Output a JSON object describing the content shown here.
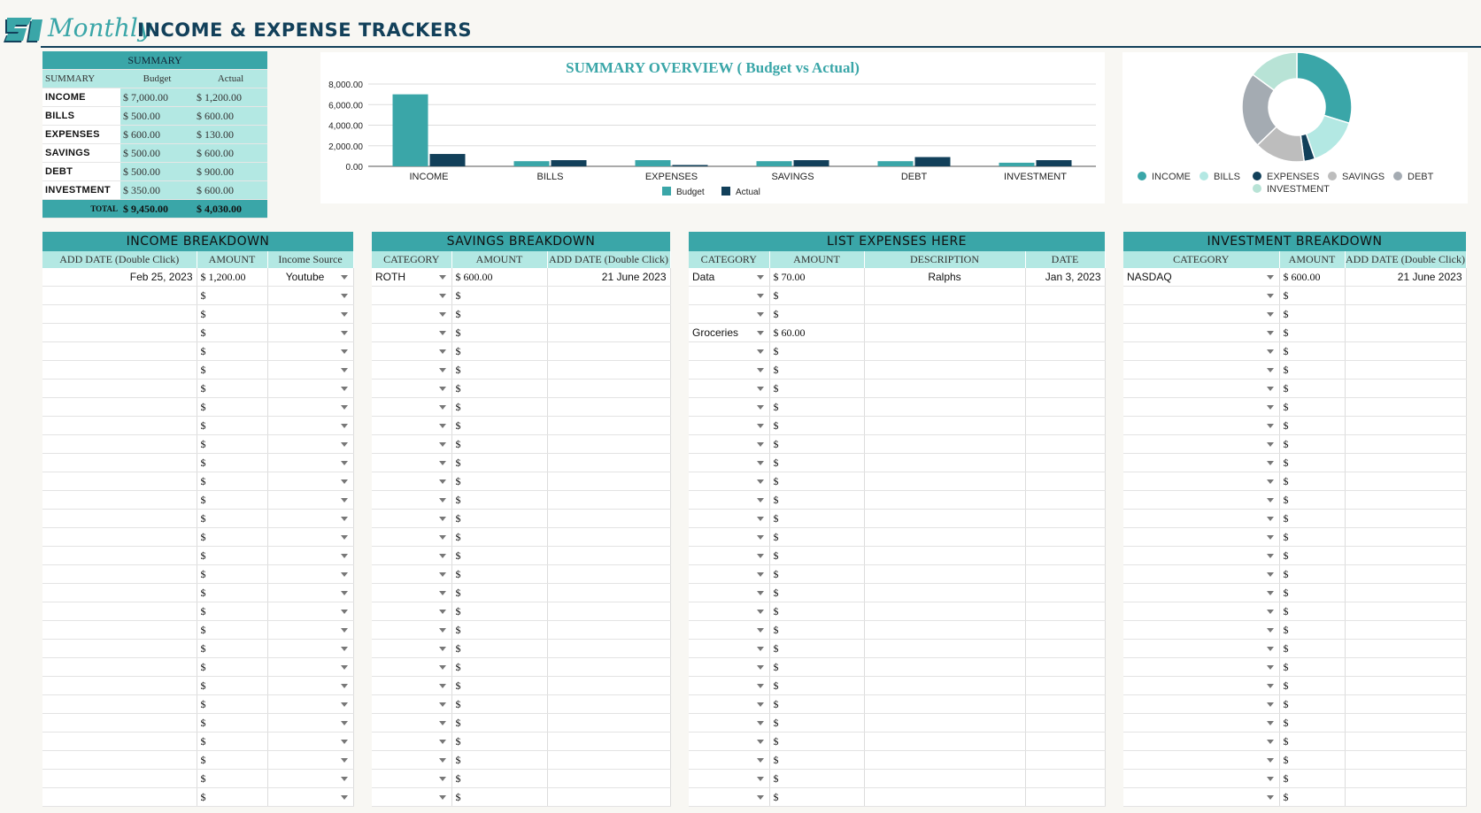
{
  "header": {
    "logo_text": "SI",
    "title_script": "Monthly",
    "title_main": "INCOME & EXPENSE TRACKERS"
  },
  "summary": {
    "title": "SUMMARY",
    "col_label": "SUMMARY",
    "col_budget": "Budget",
    "col_actual": "Actual",
    "rows": [
      {
        "label": "INCOME",
        "budget": "$ 7,000.00",
        "actual": "$ 1,200.00"
      },
      {
        "label": "BILLS",
        "budget": "$ 500.00",
        "actual": "$ 600.00"
      },
      {
        "label": "EXPENSES",
        "budget": "$ 600.00",
        "actual": "$ 130.00"
      },
      {
        "label": "SAVINGS",
        "budget": "$ 500.00",
        "actual": "$ 600.00"
      },
      {
        "label": "DEBT",
        "budget": "$ 500.00",
        "actual": "$ 900.00"
      },
      {
        "label": "INVESTMENT",
        "budget": "$ 350.00",
        "actual": "$ 600.00"
      }
    ],
    "total_label": "TOTAL",
    "total_budget": "$ 9,450.00",
    "total_actual": "$ 4,030.00"
  },
  "colors": {
    "teal": "#3aa6a8",
    "light_teal": "#b3e8e3",
    "navy": "#12405a",
    "gray": "#bdbdbd",
    "slate": "#a4abb2",
    "mint": "#b8e3d6"
  },
  "chart_data": [
    {
      "type": "bar",
      "title": "SUMMARY OVERVIEW ( Budget  vs Actual)",
      "categories": [
        "INCOME",
        "BILLS",
        "EXPENSES",
        "SAVINGS",
        "DEBT",
        "INVESTMENT"
      ],
      "series": [
        {
          "name": "Budget",
          "color": "#3aa6a8",
          "values": [
            7000,
            500,
            600,
            500,
            500,
            350
          ]
        },
        {
          "name": "Actual",
          "color": "#12405a",
          "values": [
            1200,
            600,
            130,
            600,
            900,
            600
          ]
        }
      ],
      "yticks": [
        "8,000.00",
        "6,000.00",
        "4,000.00",
        "2,000.00",
        "0.00"
      ],
      "ylim": [
        0,
        8000
      ],
      "legend": "bottom",
      "grid": true
    },
    {
      "type": "pie",
      "donut": true,
      "labels": [
        "INCOME",
        "BILLS",
        "EXPENSES",
        "SAVINGS",
        "DEBT",
        "INVESTMENT"
      ],
      "values": [
        1200,
        600,
        130,
        600,
        900,
        600
      ],
      "colors": [
        "#3aa6a8",
        "#b3e8e3",
        "#12405a",
        "#bdbdbd",
        "#a4abb2",
        "#b8e3d6"
      ],
      "legend": "bottom"
    }
  ],
  "income": {
    "title": "INCOME BREAKDOWN",
    "headers": [
      "ADD DATE (Double Click)",
      "AMOUNT",
      "Income Source"
    ],
    "rows": [
      [
        "Feb 25, 2023",
        "$ 1,200.00",
        "Youtube"
      ],
      [
        "",
        "$",
        ""
      ],
      [
        "",
        "$",
        ""
      ],
      [
        "",
        "$",
        ""
      ],
      [
        "",
        "$",
        ""
      ],
      [
        "",
        "$",
        ""
      ],
      [
        "",
        "$",
        ""
      ],
      [
        "",
        "$",
        ""
      ],
      [
        "",
        "$",
        ""
      ],
      [
        "",
        "$",
        ""
      ],
      [
        "",
        "$",
        ""
      ],
      [
        "",
        "$",
        ""
      ],
      [
        "",
        "$",
        ""
      ],
      [
        "",
        "$",
        ""
      ],
      [
        "",
        "$",
        ""
      ],
      [
        "",
        "$",
        ""
      ],
      [
        "",
        "$",
        ""
      ],
      [
        "",
        "$",
        ""
      ],
      [
        "",
        "$",
        ""
      ],
      [
        "",
        "$",
        ""
      ],
      [
        "",
        "$",
        ""
      ],
      [
        "",
        "$",
        ""
      ],
      [
        "",
        "$",
        ""
      ],
      [
        "",
        "$",
        ""
      ],
      [
        "",
        "$",
        ""
      ],
      [
        "",
        "$",
        ""
      ],
      [
        "",
        "$",
        ""
      ],
      [
        "",
        "$",
        ""
      ],
      [
        "",
        "$",
        ""
      ]
    ]
  },
  "savings": {
    "title": "SAVINGS BREAKDOWN",
    "headers": [
      "CATEGORY",
      "AMOUNT",
      "ADD DATE (Double Click)"
    ],
    "rows": [
      [
        "ROTH",
        "$ 600.00",
        "21 June 2023"
      ],
      [
        "",
        "$",
        ""
      ],
      [
        "",
        "$",
        ""
      ],
      [
        "",
        "$",
        ""
      ],
      [
        "",
        "$",
        ""
      ],
      [
        "",
        "$",
        ""
      ],
      [
        "",
        "$",
        ""
      ],
      [
        "",
        "$",
        ""
      ],
      [
        "",
        "$",
        ""
      ],
      [
        "",
        "$",
        ""
      ],
      [
        "",
        "$",
        ""
      ],
      [
        "",
        "$",
        ""
      ],
      [
        "",
        "$",
        ""
      ],
      [
        "",
        "$",
        ""
      ],
      [
        "",
        "$",
        ""
      ],
      [
        "",
        "$",
        ""
      ],
      [
        "",
        "$",
        ""
      ],
      [
        "",
        "$",
        ""
      ],
      [
        "",
        "$",
        ""
      ],
      [
        "",
        "$",
        ""
      ],
      [
        "",
        "$",
        ""
      ],
      [
        "",
        "$",
        ""
      ],
      [
        "",
        "$",
        ""
      ],
      [
        "",
        "$",
        ""
      ],
      [
        "",
        "$",
        ""
      ],
      [
        "",
        "$",
        ""
      ],
      [
        "",
        "$",
        ""
      ],
      [
        "",
        "$",
        ""
      ],
      [
        "",
        "$",
        ""
      ]
    ]
  },
  "expenses": {
    "title": "LIST EXPENSES HERE",
    "headers": [
      "CATEGORY",
      "AMOUNT",
      "DESCRIPTION",
      "DATE"
    ],
    "rows": [
      [
        "Data",
        "$ 70.00",
        "Ralphs",
        "Jan 3, 2023"
      ],
      [
        "",
        "$",
        "",
        ""
      ],
      [
        "",
        "$",
        "",
        ""
      ],
      [
        "Groceries",
        "$ 60.00",
        "",
        ""
      ],
      [
        "",
        "$",
        "",
        ""
      ],
      [
        "",
        "$",
        "",
        ""
      ],
      [
        "",
        "$",
        "",
        ""
      ],
      [
        "",
        "$",
        "",
        ""
      ],
      [
        "",
        "$",
        "",
        ""
      ],
      [
        "",
        "$",
        "",
        ""
      ],
      [
        "",
        "$",
        "",
        ""
      ],
      [
        "",
        "$",
        "",
        ""
      ],
      [
        "",
        "$",
        "",
        ""
      ],
      [
        "",
        "$",
        "",
        ""
      ],
      [
        "",
        "$",
        "",
        ""
      ],
      [
        "",
        "$",
        "",
        ""
      ],
      [
        "",
        "$",
        "",
        ""
      ],
      [
        "",
        "$",
        "",
        ""
      ],
      [
        "",
        "$",
        "",
        ""
      ],
      [
        "",
        "$",
        "",
        ""
      ],
      [
        "",
        "$",
        "",
        ""
      ],
      [
        "",
        "$",
        "",
        ""
      ],
      [
        "",
        "$",
        "",
        ""
      ],
      [
        "",
        "$",
        "",
        ""
      ],
      [
        "",
        "$",
        "",
        ""
      ],
      [
        "",
        "$",
        "",
        ""
      ],
      [
        "",
        "$",
        "",
        ""
      ],
      [
        "",
        "$",
        "",
        ""
      ],
      [
        "",
        "$",
        "",
        ""
      ]
    ]
  },
  "investment": {
    "title": "INVESTMENT BREAKDOWN",
    "headers": [
      "CATEGORY",
      "AMOUNT",
      "ADD DATE (Double Click)"
    ],
    "rows": [
      [
        "NASDAQ",
        "$ 600.00",
        "21 June 2023"
      ],
      [
        "",
        "$",
        ""
      ],
      [
        "",
        "$",
        ""
      ],
      [
        "",
        "$",
        ""
      ],
      [
        "",
        "$",
        ""
      ],
      [
        "",
        "$",
        ""
      ],
      [
        "",
        "$",
        ""
      ],
      [
        "",
        "$",
        ""
      ],
      [
        "",
        "$",
        ""
      ],
      [
        "",
        "$",
        ""
      ],
      [
        "",
        "$",
        ""
      ],
      [
        "",
        "$",
        ""
      ],
      [
        "",
        "$",
        ""
      ],
      [
        "",
        "$",
        ""
      ],
      [
        "",
        "$",
        ""
      ],
      [
        "",
        "$",
        ""
      ],
      [
        "",
        "$",
        ""
      ],
      [
        "",
        "$",
        ""
      ],
      [
        "",
        "$",
        ""
      ],
      [
        "",
        "$",
        ""
      ],
      [
        "",
        "$",
        ""
      ],
      [
        "",
        "$",
        ""
      ],
      [
        "",
        "$",
        ""
      ],
      [
        "",
        "$",
        ""
      ],
      [
        "",
        "$",
        ""
      ],
      [
        "",
        "$",
        ""
      ],
      [
        "",
        "$",
        ""
      ],
      [
        "",
        "$",
        ""
      ],
      [
        "",
        "$",
        ""
      ]
    ]
  }
}
